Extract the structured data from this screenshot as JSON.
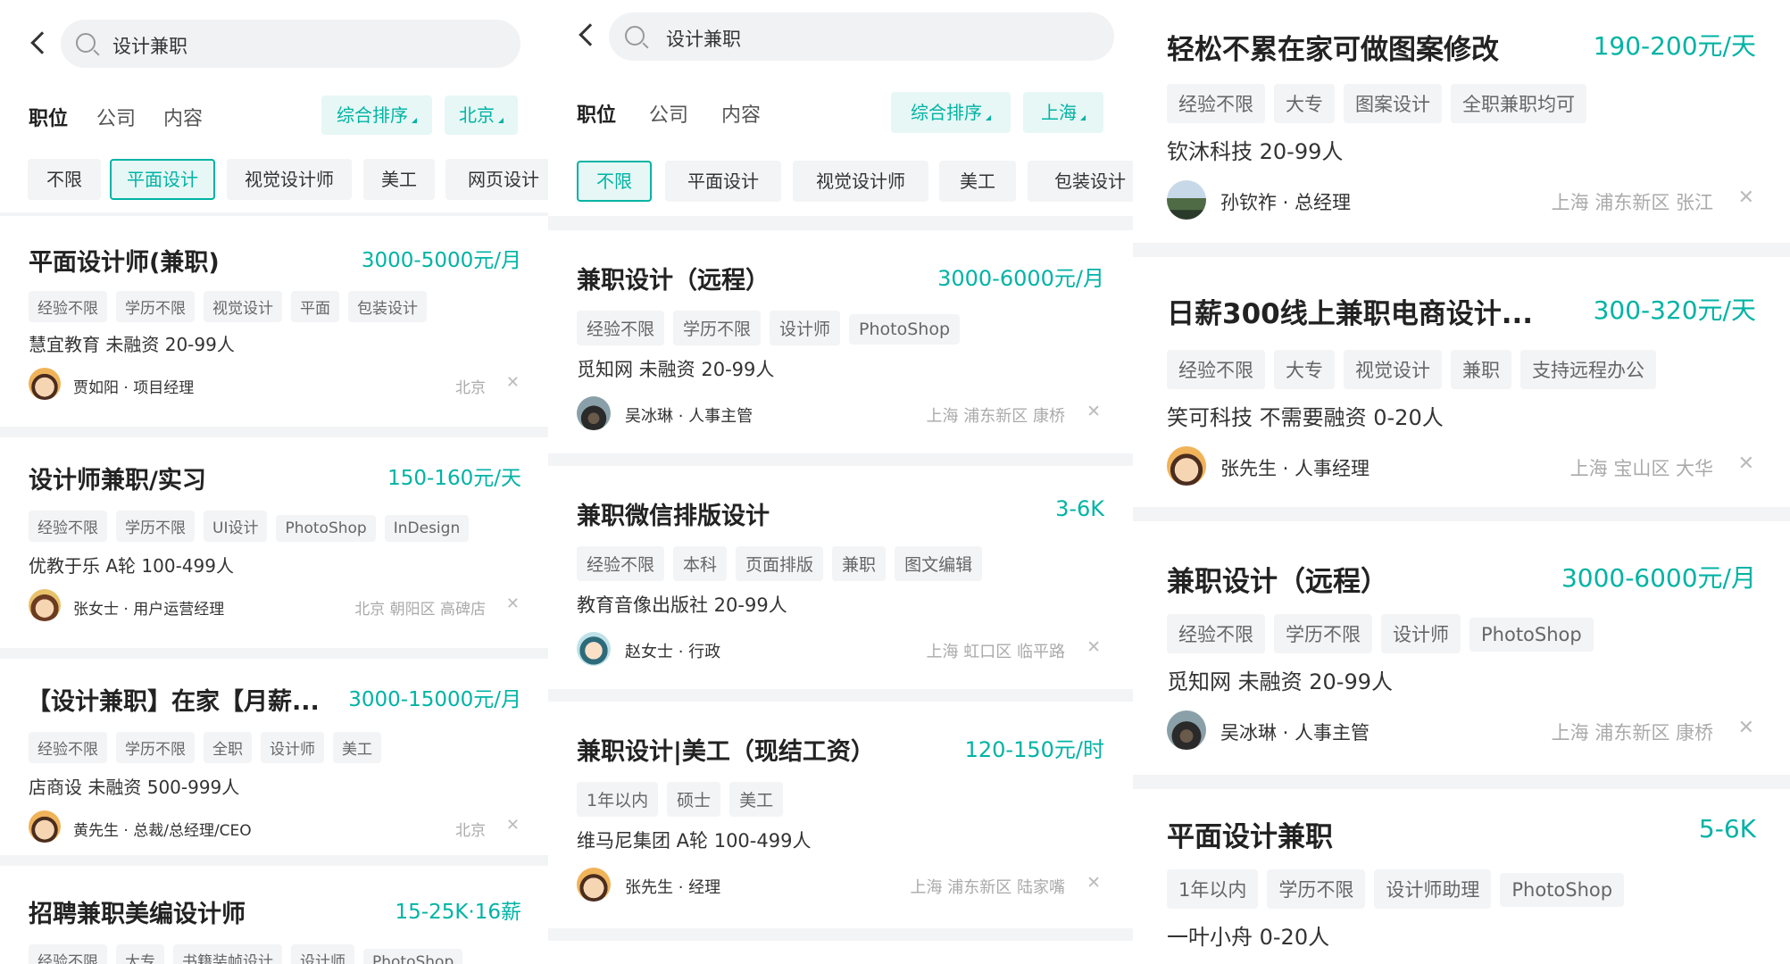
{
  "colors": {
    "accent": "#00b3a4",
    "accent_bg": "#e6f7f5",
    "tag_bg": "#f3f4f6",
    "muted": "#aaaaaa"
  },
  "panels": [
    {
      "search": {
        "query": "设计兼职"
      },
      "tabs": [
        "职位",
        "公司",
        "内容"
      ],
      "sort_label": "综合排序",
      "city_label": "北京",
      "chips": [
        "不限",
        "平面设计",
        "视觉设计师",
        "美工",
        "网页设计"
      ],
      "jobs": [
        {
          "title": "平面设计师(兼职)",
          "salary": "3000-5000元/月",
          "tags": [
            "经验不限",
            "学历不限",
            "视觉设计",
            "平面",
            "包装设计"
          ],
          "company": "慧宜教育 未融资 20-99人",
          "recruiter": "贾如阳 · 项目经理",
          "location": "北京"
        },
        {
          "title": "设计师兼职/实习",
          "salary": "150-160元/天",
          "tags": [
            "经验不限",
            "学历不限",
            "UI设计",
            "PhotoShop",
            "InDesign"
          ],
          "company": "优教于乐 A轮 100-499人",
          "recruiter": "张女士 · 用户运营经理",
          "location": "北京  朝阳区  高碑店"
        },
        {
          "title": "【设计兼职】在家【月薪...",
          "salary": "3000-15000元/月",
          "tags": [
            "经验不限",
            "学历不限",
            "全职",
            "设计师",
            "美工"
          ],
          "company": "店商设 未融资 500-999人",
          "recruiter": "黄先生 · 总裁/总经理/CEO",
          "location": "北京"
        },
        {
          "title": "招聘兼职美编设计师",
          "salary": "15-25K·16薪",
          "tags": [
            "经验不限",
            "大专",
            "书籍装帧设计",
            "设计师",
            "PhotoShop"
          ],
          "company": "",
          "recruiter": "",
          "location": ""
        }
      ]
    },
    {
      "search": {
        "query": "设计兼职"
      },
      "tabs": [
        "职位",
        "公司",
        "内容"
      ],
      "sort_label": "综合排序",
      "city_label": "上海",
      "chips": [
        "不限",
        "平面设计",
        "视觉设计师",
        "美工",
        "包装设计"
      ],
      "jobs": [
        {
          "title": "兼职设计（远程）",
          "salary": "3000-6000元/月",
          "tags": [
            "经验不限",
            "学历不限",
            "设计师",
            "PhotoShop"
          ],
          "company": "觅知网 未融资 20-99人",
          "recruiter": "吴冰琳 · 人事主管",
          "location": "上海  浦东新区  康桥"
        },
        {
          "title": "兼职微信排版设计",
          "salary": "3-6K",
          "tags": [
            "经验不限",
            "本科",
            "页面排版",
            "兼职",
            "图文编辑"
          ],
          "company": "教育音像出版社  20-99人",
          "recruiter": "赵女士 · 行政",
          "location": "上海  虹口区  临平路"
        },
        {
          "title": "兼职设计|美工（现结工资）",
          "salary": "120-150元/时",
          "tags": [
            "1年以内",
            "硕士",
            "美工"
          ],
          "company": "维马尼集团 A轮 100-499人",
          "recruiter": "张先生 · 经理",
          "location": "上海  浦东新区  陆家嘴"
        }
      ]
    },
    {
      "jobs": [
        {
          "title": "轻松不累在家可做图案修改",
          "salary": "190-200元/天",
          "tags": [
            "经验不限",
            "大专",
            "图案设计",
            "全职兼职均可"
          ],
          "company": "钦沐科技 20-99人",
          "recruiter": "孙钦祚 · 总经理",
          "location": "上海  浦东新区  张江"
        },
        {
          "title": "日薪300线上兼职电商设计...",
          "salary": "300-320元/天",
          "tags": [
            "经验不限",
            "大专",
            "视觉设计",
            "兼职",
            "支持远程办公"
          ],
          "company": "笑可科技 不需要融资 0-20人",
          "recruiter": "张先生 · 人事经理",
          "location": "上海  宝山区  大华"
        },
        {
          "title": "兼职设计（远程）",
          "salary": "3000-6000元/月",
          "tags": [
            "经验不限",
            "学历不限",
            "设计师",
            "PhotoShop"
          ],
          "company": "觅知网 未融资 20-99人",
          "recruiter": "吴冰琳 · 人事主管",
          "location": "上海  浦东新区  康桥"
        },
        {
          "title": "平面设计兼职",
          "salary": "5-6K",
          "tags": [
            "1年以内",
            "学历不限",
            "设计师助理",
            "PhotoShop"
          ],
          "company": "一叶小舟  0-20人",
          "recruiter": "",
          "location": ""
        }
      ]
    }
  ],
  "close_glyph": "✕"
}
